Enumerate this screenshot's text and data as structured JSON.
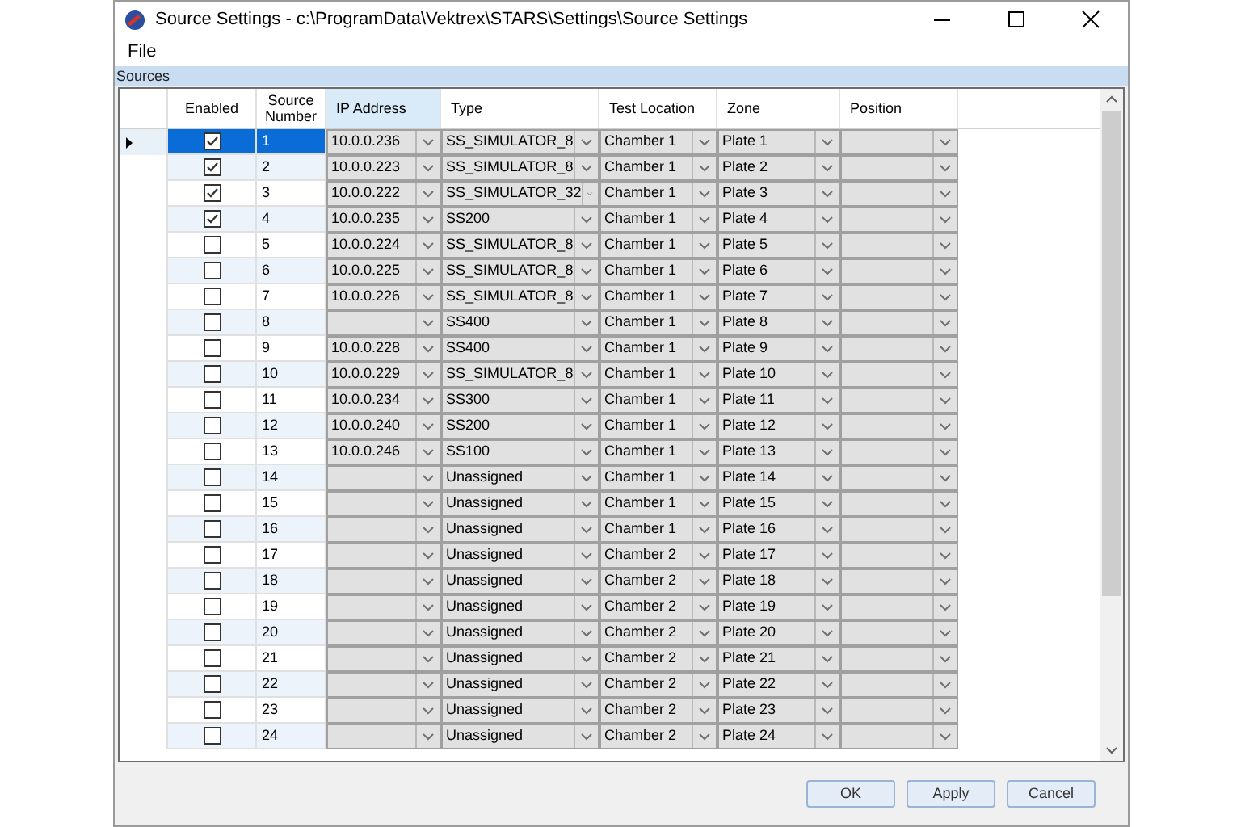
{
  "window": {
    "title": "Source Settings - c:\\ProgramData\\Vektrex\\STARS\\Settings\\Source Settings"
  },
  "menu": [
    "File"
  ],
  "group": {
    "title": "Sources"
  },
  "table": {
    "columns": [
      "Enabled",
      "Source Number",
      "IP Address",
      "Type",
      "Test Location",
      "Zone",
      "Position"
    ],
    "rows": [
      {
        "selected": true,
        "enabled": true,
        "number": "1",
        "ip": "10.0.0.236",
        "type": "SS_SIMULATOR_8",
        "location": "Chamber 1",
        "zone": "Plate 1"
      },
      {
        "selected": false,
        "enabled": true,
        "number": "2",
        "ip": "10.0.0.223",
        "type": "SS_SIMULATOR_8",
        "location": "Chamber 1",
        "zone": "Plate 2"
      },
      {
        "selected": false,
        "enabled": true,
        "number": "3",
        "ip": "10.0.0.222",
        "type": "SS_SIMULATOR_32",
        "location": "Chamber 1",
        "zone": "Plate 3"
      },
      {
        "selected": false,
        "enabled": true,
        "number": "4",
        "ip": "10.0.0.235",
        "type": "SS200",
        "location": "Chamber 1",
        "zone": "Plate 4"
      },
      {
        "selected": false,
        "enabled": false,
        "number": "5",
        "ip": "10.0.0.224",
        "type": "SS_SIMULATOR_8",
        "location": "Chamber 1",
        "zone": "Plate 5"
      },
      {
        "selected": false,
        "enabled": false,
        "number": "6",
        "ip": "10.0.0.225",
        "type": "SS_SIMULATOR_8",
        "location": "Chamber 1",
        "zone": "Plate 6"
      },
      {
        "selected": false,
        "enabled": false,
        "number": "7",
        "ip": "10.0.0.226",
        "type": "SS_SIMULATOR_8",
        "location": "Chamber 1",
        "zone": "Plate 7"
      },
      {
        "selected": false,
        "enabled": false,
        "number": "8",
        "type": "SS400",
        "location": "Chamber 1",
        "zone": "Plate 8"
      },
      {
        "selected": false,
        "enabled": false,
        "number": "9",
        "ip": "10.0.0.228",
        "type": "SS400",
        "location": "Chamber 1",
        "zone": "Plate 9"
      },
      {
        "selected": false,
        "enabled": false,
        "number": "10",
        "ip": "10.0.0.229",
        "type": "SS_SIMULATOR_8",
        "location": "Chamber 1",
        "zone": "Plate 10"
      },
      {
        "selected": false,
        "enabled": false,
        "number": "11",
        "ip": "10.0.0.234",
        "type": "SS300",
        "location": "Chamber 1",
        "zone": "Plate 11"
      },
      {
        "selected": false,
        "enabled": false,
        "number": "12",
        "ip": "10.0.0.240",
        "type": "SS200",
        "location": "Chamber 1",
        "zone": "Plate 12"
      },
      {
        "selected": false,
        "enabled": false,
        "number": "13",
        "ip": "10.0.0.246",
        "type": "SS100",
        "location": "Chamber 1",
        "zone": "Plate 13"
      },
      {
        "selected": false,
        "enabled": false,
        "number": "14",
        "type": "Unassigned",
        "location": "Chamber 1",
        "zone": "Plate 14"
      },
      {
        "selected": false,
        "enabled": false,
        "number": "15",
        "type": "Unassigned",
        "location": "Chamber 1",
        "zone": "Plate 15"
      },
      {
        "selected": false,
        "enabled": false,
        "number": "16",
        "type": "Unassigned",
        "location": "Chamber 1",
        "zone": "Plate 16"
      },
      {
        "selected": false,
        "enabled": false,
        "number": "17",
        "type": "Unassigned",
        "location": "Chamber 2",
        "zone": "Plate 17"
      },
      {
        "selected": false,
        "enabled": false,
        "number": "18",
        "type": "Unassigned",
        "location": "Chamber 2",
        "zone": "Plate 18"
      },
      {
        "selected": false,
        "enabled": false,
        "number": "19",
        "type": "Unassigned",
        "location": "Chamber 2",
        "zone": "Plate 19"
      },
      {
        "selected": false,
        "enabled": false,
        "number": "20",
        "type": "Unassigned",
        "location": "Chamber 2",
        "zone": "Plate 20"
      },
      {
        "selected": false,
        "enabled": false,
        "number": "21",
        "type": "Unassigned",
        "location": "Chamber 2",
        "zone": "Plate 21"
      },
      {
        "selected": false,
        "enabled": false,
        "number": "22",
        "type": "Unassigned",
        "location": "Chamber 2",
        "zone": "Plate 22"
      },
      {
        "selected": false,
        "enabled": false,
        "number": "23",
        "type": "Unassigned",
        "location": "Chamber 2",
        "zone": "Plate 23"
      },
      {
        "selected": false,
        "enabled": false,
        "number": "24",
        "type": "Unassigned",
        "location": "Chamber 2",
        "zone": "Plate 24"
      }
    ]
  },
  "buttons": [
    "OK",
    "Apply",
    "Cancel"
  ]
}
